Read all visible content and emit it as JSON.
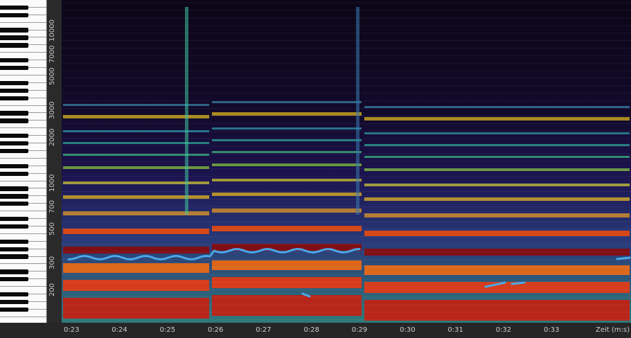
{
  "y_axis": {
    "ticks": [
      {
        "label": "10000",
        "hz": 10000
      },
      {
        "label": "7000",
        "hz": 7000
      },
      {
        "label": "5000",
        "hz": 5000
      },
      {
        "label": "3000",
        "hz": 3000
      },
      {
        "label": "2000",
        "hz": 2000
      },
      {
        "label": "1000",
        "hz": 1000
      },
      {
        "label": "700",
        "hz": 700
      },
      {
        "label": "500",
        "hz": 500
      },
      {
        "label": "300",
        "hz": 300
      },
      {
        "label": "200",
        "hz": 200
      }
    ],
    "scale": "log"
  },
  "x_axis": {
    "ticks": [
      "0:23",
      "0:24",
      "0:25",
      "0:26",
      "0:27",
      "0:28",
      "0:29",
      "0:30",
      "0:31",
      "0:32",
      "0:33"
    ],
    "label": "Zeit (m:s)"
  },
  "colors": {
    "pitch_line": "#4aa8e8",
    "background": "#1b1b1b",
    "spectrum_low": "#1a0a2e",
    "spectrum_high": "#8b0000"
  }
}
